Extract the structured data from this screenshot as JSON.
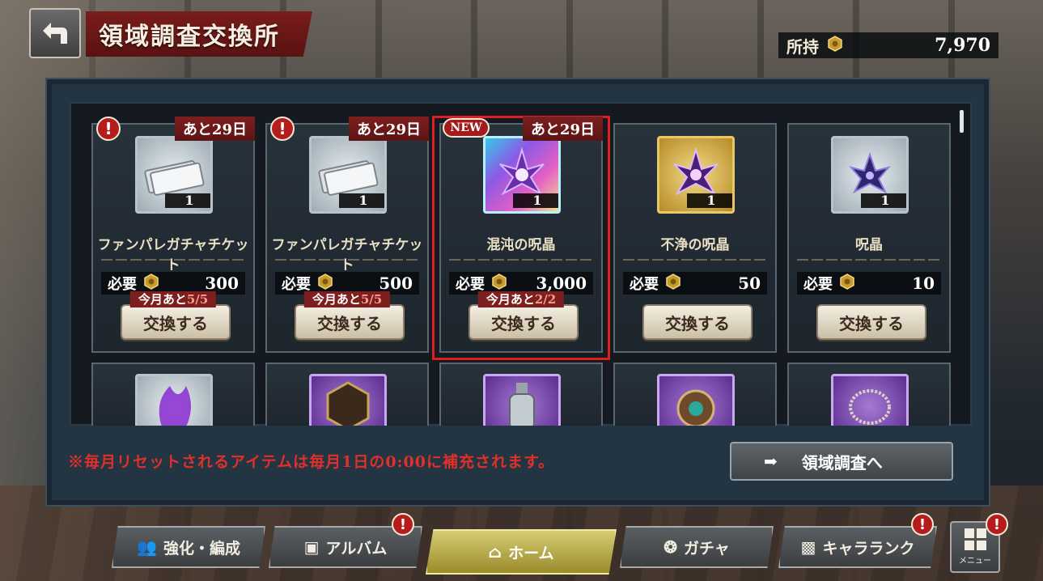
{
  "header": {
    "title": "領域調査交換所",
    "holdings_label": "所持",
    "holdings_value": "7,970"
  },
  "cards": [
    {
      "alert": "!",
      "new": "",
      "days_left": "あと29日",
      "qty": "1",
      "name": "ファンパレガチャチケット",
      "req_label": "必要",
      "cost": "300",
      "limit_prefix": "今月あと",
      "limit_used": "5/5",
      "exchange_label": "交換する",
      "icon": "ticket-icon"
    },
    {
      "alert": "!",
      "new": "",
      "days_left": "あと29日",
      "qty": "1",
      "name": "ファンパレガチャチケット",
      "req_label": "必要",
      "cost": "500",
      "limit_prefix": "今月あと",
      "limit_used": "5/5",
      "exchange_label": "交換する",
      "icon": "ticket-icon"
    },
    {
      "alert": "",
      "new": "NEW",
      "days_left": "あと29日",
      "qty": "1",
      "name": "混沌の呪晶",
      "req_label": "必要",
      "cost": "3,000",
      "limit_prefix": "今月あと",
      "limit_used": "2/2",
      "exchange_label": "交換する",
      "icon": "crystal-icon"
    },
    {
      "alert": "",
      "new": "",
      "days_left": "",
      "qty": "1",
      "name": "不浄の呪晶",
      "req_label": "必要",
      "cost": "50",
      "limit_prefix": "",
      "limit_used": "",
      "exchange_label": "交換する",
      "icon": "crystal-icon"
    },
    {
      "alert": "",
      "new": "",
      "days_left": "",
      "qty": "1",
      "name": "呪晶",
      "req_label": "必要",
      "cost": "10",
      "limit_prefix": "",
      "limit_used": "",
      "exchange_label": "交換する",
      "icon": "crystal-icon"
    }
  ],
  "row2_icons": [
    "cursed-aura-icon",
    "hexagon-talisman-icon",
    "bottle-icon",
    "amulet-icon",
    "necklace-icon"
  ],
  "notice": "※毎月リセットされるアイテムは毎月1日の0:00に補充されます。",
  "goto_button": "領域調査へ",
  "nav": {
    "enhance": "強化・編成",
    "album": "アルバム",
    "home": "ホーム",
    "gacha": "ガチャ",
    "chara_rank": "キャラランク",
    "menu": "メニュー",
    "alert": "!"
  },
  "colors": {
    "accent_red": "#b51d1d",
    "highlight": "#e0201e",
    "active_nav": "#d7cc74"
  }
}
